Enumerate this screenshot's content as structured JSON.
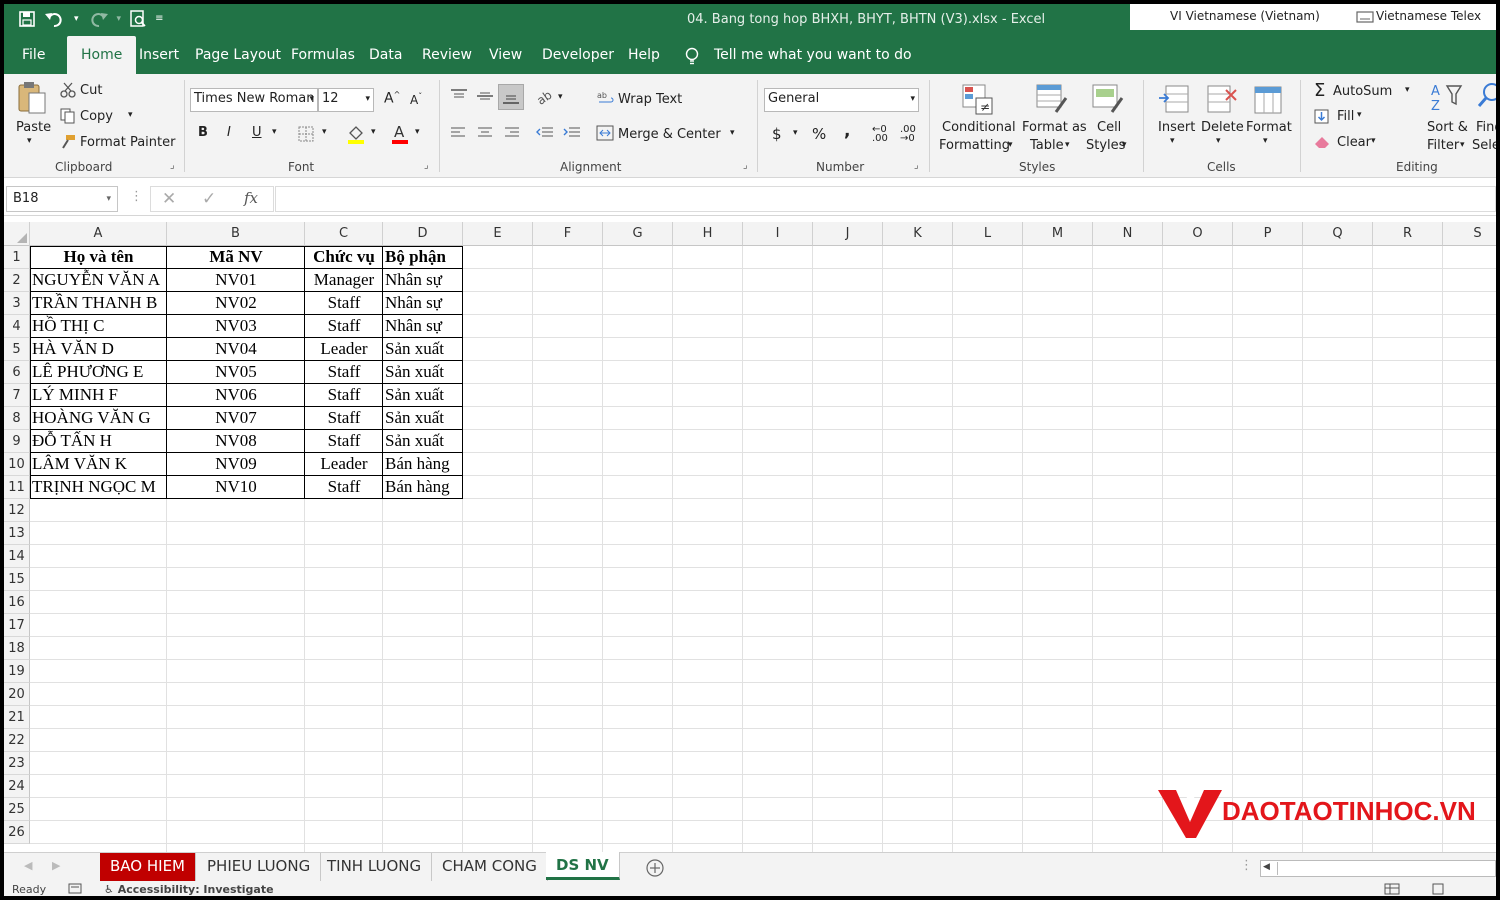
{
  "window": {
    "title": "04. Bang tong hop BHXH, BHYT, BHTN (V3).xlsx  -  Excel",
    "lang_1": "VI  Vietnamese (Vietnam)",
    "lang_2": "Vietnamese Telex"
  },
  "menu_tabs": [
    "File",
    "Home",
    "Insert",
    "Page Layout",
    "Formulas",
    "Data",
    "Review",
    "View",
    "Developer",
    "Help"
  ],
  "tell_me": "Tell me what you want to do",
  "ribbon": {
    "clipboard": {
      "paste": "Paste",
      "cut": "Cut",
      "copy": "Copy",
      "format_painter": "Format Painter",
      "label": "Clipboard"
    },
    "font": {
      "name": "Times New Roman",
      "size": "12",
      "bold": "B",
      "italic": "I",
      "underline": "U",
      "label": "Font"
    },
    "alignment": {
      "wrap_text": "Wrap Text",
      "merge_center": "Merge & Center",
      "label": "Alignment"
    },
    "number": {
      "format": "General",
      "currency": "$",
      "percent": "%",
      "comma": ",",
      "label": "Number"
    },
    "styles": {
      "conditional_1": "Conditional",
      "conditional_2": "Formatting",
      "format_as_table_1": "Format as",
      "format_as_table_2": "Table",
      "cell_styles_1": "Cell",
      "cell_styles_2": "Styles",
      "label": "Styles"
    },
    "cells": {
      "insert": "Insert",
      "delete": "Delete",
      "format": "Format",
      "label": "Cells"
    },
    "editing": {
      "autosum": "AutoSum",
      "fill": "Fill",
      "clear": "Clear",
      "sort_1": "Sort &",
      "sort_2": "Filter",
      "find_1": "Find",
      "find_2": "Sele",
      "label": "Editing"
    }
  },
  "formula_bar": {
    "name_box": "B18",
    "fx": "fx",
    "formula": ""
  },
  "columns": [
    "A",
    "B",
    "C",
    "D",
    "E",
    "F",
    "G",
    "H",
    "I",
    "J",
    "K",
    "L",
    "M",
    "N",
    "O",
    "P",
    "Q",
    "R",
    "S"
  ],
  "rows": [
    "1",
    "2",
    "3",
    "4",
    "5",
    "6",
    "7",
    "8",
    "9",
    "10",
    "11",
    "12",
    "13",
    "14",
    "15",
    "16",
    "17",
    "18",
    "19",
    "20",
    "21",
    "22",
    "23",
    "24",
    "25",
    "26"
  ],
  "table": {
    "headers": [
      "Họ và tên",
      "Mã NV",
      "Chức vụ",
      "Bộ phận"
    ],
    "rows": [
      [
        "NGUYỄN VĂN A",
        "NV01",
        "Manager",
        "Nhân sự"
      ],
      [
        "TRẦN THANH B",
        "NV02",
        "Staff",
        "Nhân sự"
      ],
      [
        "HỒ THỊ C",
        "NV03",
        "Staff",
        "Nhân sự"
      ],
      [
        "HÀ VĂN D",
        "NV04",
        "Leader",
        "Sản xuất"
      ],
      [
        "LÊ PHƯƠNG E",
        "NV05",
        "Staff",
        "Sản xuất"
      ],
      [
        "LÝ MINH F",
        "NV06",
        "Staff",
        "Sản xuất"
      ],
      [
        "HOÀNG VĂN G",
        "NV07",
        "Staff",
        "Sản xuất"
      ],
      [
        "ĐỖ TẤN H",
        "NV08",
        "Staff",
        "Sản xuất"
      ],
      [
        "LÂM VĂN K",
        "NV09",
        "Leader",
        "Bán hàng"
      ],
      [
        "TRỊNH NGỌC M",
        "NV10",
        "Staff",
        "Bán hàng"
      ]
    ]
  },
  "sheet_tabs": [
    "BAO HIEM",
    "PHIEU LUONG",
    "TINH LUONG",
    "CHAM CONG",
    "DS NV"
  ],
  "active_sheet": "DS NV",
  "status": {
    "ready": "Ready",
    "accessibility": "Accessibility: Investigate"
  },
  "watermark": "DAOTAOTINHOC.VN",
  "colors": {
    "excel_green": "#217346",
    "tab_red": "#c00000",
    "logo_red": "#e3161b"
  }
}
